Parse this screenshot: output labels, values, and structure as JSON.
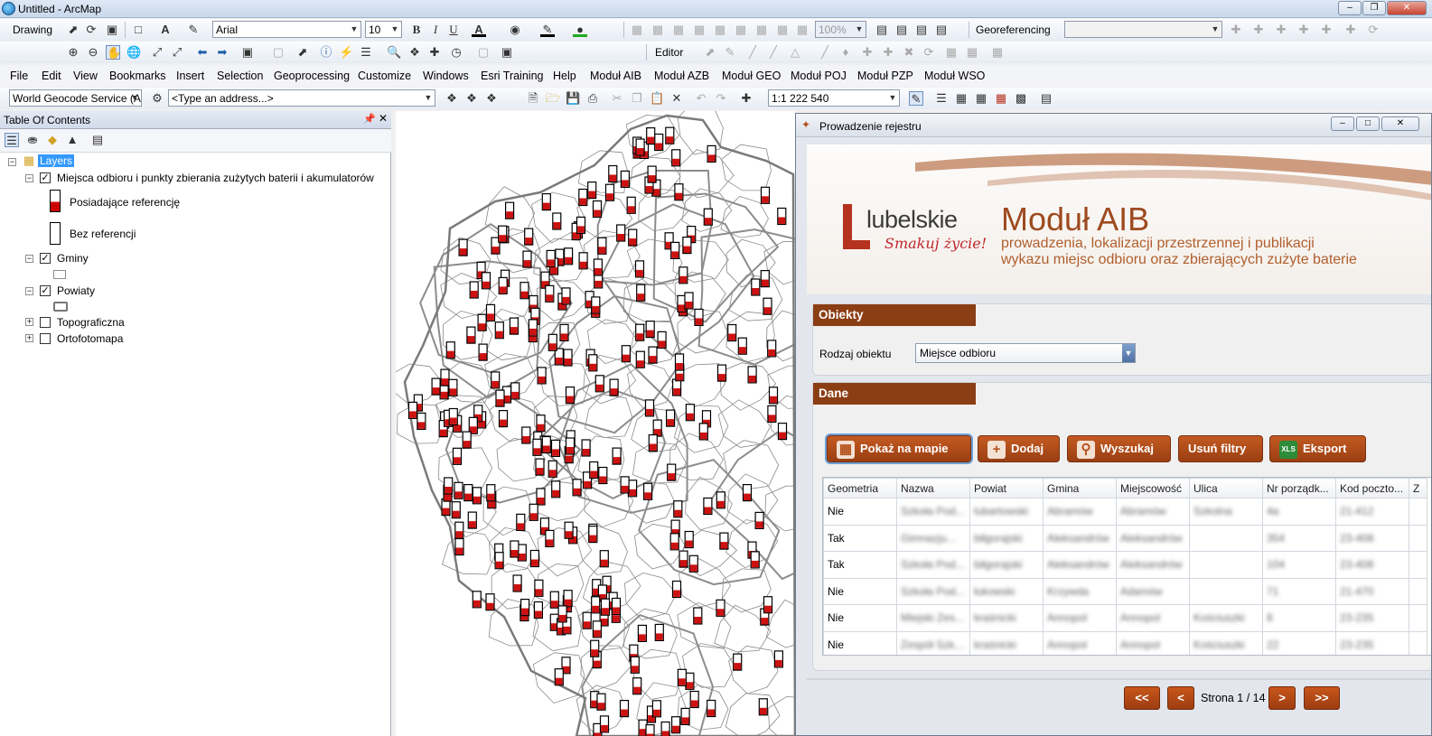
{
  "window": {
    "title": "Untitled - ArcMap"
  },
  "toolbar1": {
    "drawing": "Drawing",
    "font": "Arial",
    "size": "10",
    "bold": "B",
    "italic": "I",
    "underline": "U",
    "zoom": "100%",
    "georef": "Georeferencing"
  },
  "toolbar2": {
    "editor": "Editor"
  },
  "menu": [
    "File",
    "Edit",
    "View",
    "Bookmarks",
    "Insert",
    "Selection",
    "Geoprocessing",
    "Customize",
    "Windows",
    "Esri Training",
    "Help",
    "Moduł AIB",
    "Moduł AZB",
    "Moduł GEO",
    "Moduł POJ",
    "Moduł PZP",
    "Moduł WSO"
  ],
  "toolbar3": {
    "geocode": "World Geocode Service (A",
    "address_placeholder": "<Type an address...>",
    "scale": "1:1 222 540"
  },
  "toc": {
    "title": "Table Of Contents",
    "layers_label": "Layers",
    "layer1": "Miejsca odbioru i punkty zbierania zużytych baterii i akumulatorów",
    "legend1": "Posiadające referencję",
    "legend2": "Bez referencji",
    "layer2": "Gminy",
    "layer3": "Powiaty",
    "layer4": "Topograficzna",
    "layer5": "Ortofotomapa"
  },
  "dialog": {
    "title": "Prowadzenie rejestru",
    "brand": "lubelskie",
    "slogan": "Smakuj życie!",
    "module_title": "Moduł AIB",
    "subtitle1": "prowadzenia, lokalizacji przestrzennej i publikacji",
    "subtitle2": "wykazu miejsc odbioru oraz zbierających zużyte baterie",
    "section1": "Obiekty",
    "field_label": "Rodzaj obiektu",
    "field_value": "Miejsce odbioru",
    "section2": "Dane",
    "buttons": {
      "show": "Pokaż na mapie",
      "add": "Dodaj",
      "search": "Wyszukaj",
      "clear": "Usuń filtry",
      "export": "Eksport"
    },
    "columns": [
      "Geometria",
      "Nazwa",
      "Powiat",
      "Gmina",
      "Miejscowość",
      "Ulica",
      "Nr porządk...",
      "Kod poczto...",
      "Z"
    ],
    "rows": [
      [
        "Nie",
        "Szkoła Pod...",
        "lubartowski",
        "Abramów",
        "Abramów",
        "Szkolna",
        "4a",
        "21-412"
      ],
      [
        "Tak",
        "Gimnazju...",
        "biłgorajski",
        "Aleksandrów",
        "Aleksandrów",
        "",
        "354",
        "23-408"
      ],
      [
        "Tak",
        "Szkoła Pod...",
        "biłgorajski",
        "Aleksandrów",
        "Aleksandrów",
        "",
        "104",
        "23-408"
      ],
      [
        "Nie",
        "Szkoła Pod...",
        "łukowski",
        "Krzywda",
        "Adamów",
        "",
        "71",
        "21-470"
      ],
      [
        "Nie",
        "Miejski Zes...",
        "kraśnicki",
        "Annopol",
        "Annopol",
        "Kościuszki",
        "8",
        "23-235"
      ],
      [
        "Nie",
        "Zespół Szk...",
        "kraśnicki",
        "Annopol",
        "Annopol",
        "Kościuszki",
        "22",
        "23-235"
      ]
    ],
    "pager": {
      "first": "<<",
      "prev": "<",
      "text": "Strona 1 / 14",
      "next": ">",
      "last": ">>"
    }
  }
}
